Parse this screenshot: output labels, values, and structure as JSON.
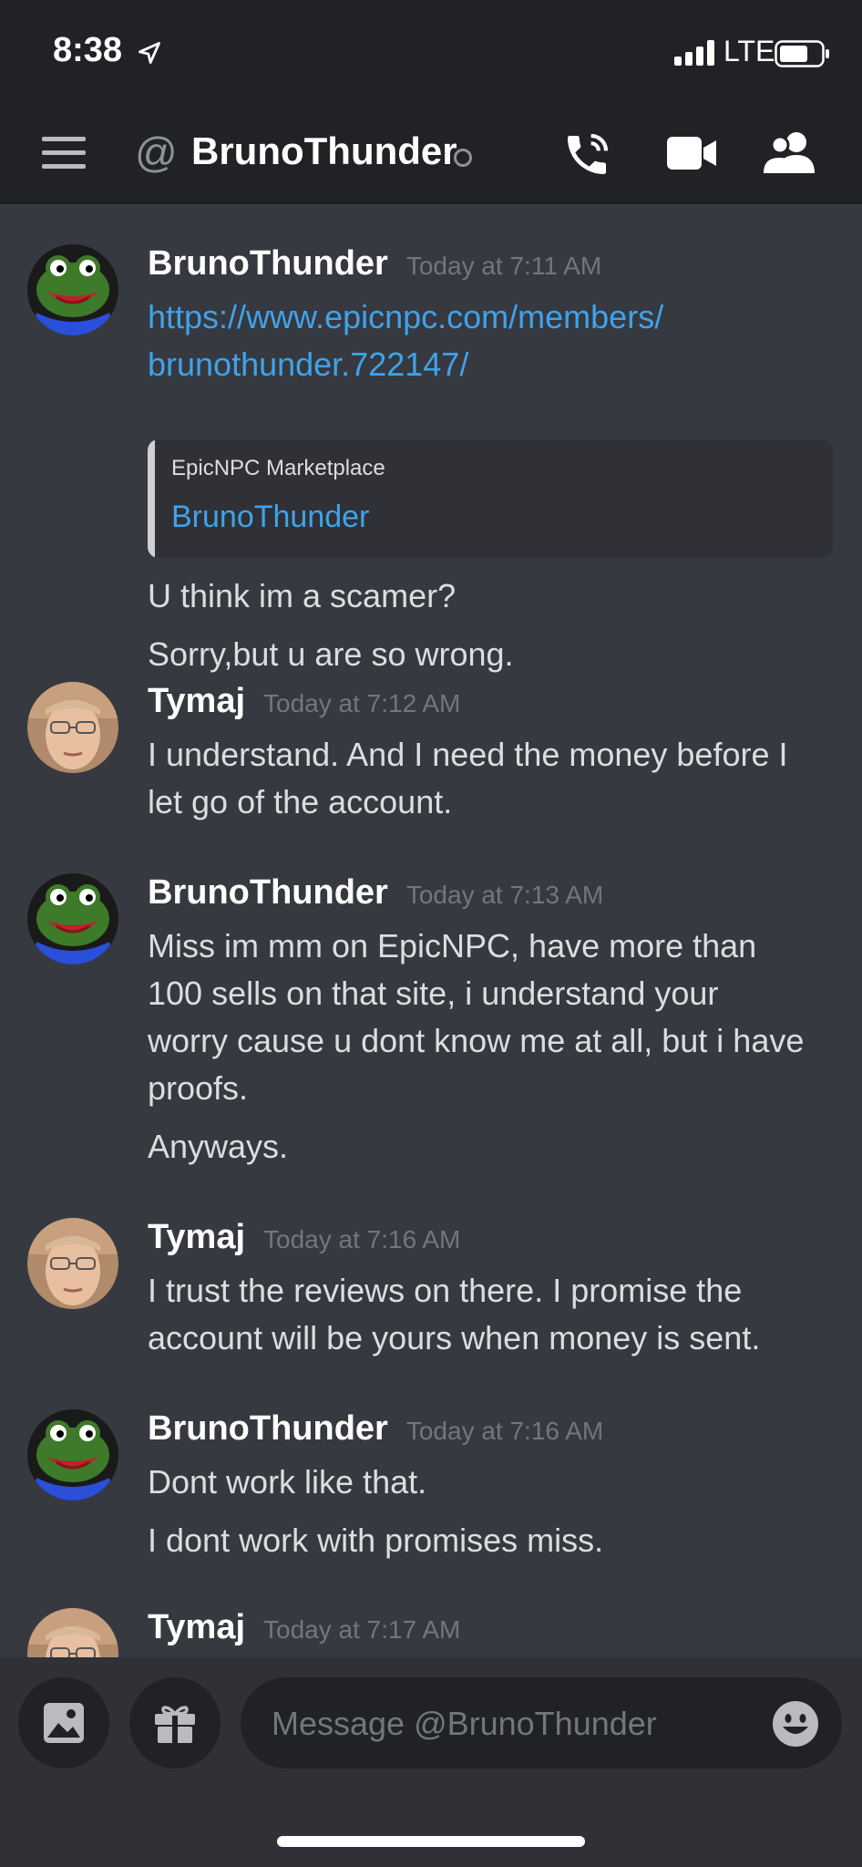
{
  "status_bar": {
    "time": "8:38",
    "network": "LTE"
  },
  "header": {
    "at_symbol": "@",
    "channel_name": "BrunoThunder"
  },
  "messages": [
    {
      "author": "BrunoThunder",
      "timestamp": "Today at 7:11 AM",
      "link_line1": "https://www.epicnpc.com/members/",
      "link_line2": "brunothunder.722147/",
      "embed": {
        "provider": "EpicNPC Marketplace",
        "title": "BrunoThunder"
      },
      "line1": "U think im a scamer?",
      "line2": "Sorry,but u are so wrong."
    },
    {
      "author": "Tymaj",
      "timestamp": "Today at 7:12 AM",
      "line1": "I understand. And I need the money before I",
      "line2": "let go of the account."
    },
    {
      "author": "BrunoThunder",
      "timestamp": "Today at 7:13 AM",
      "line1": "Miss im mm on EpicNPC, have more than",
      "line2": "100 sells on that site, i understand your",
      "line3": "worry cause u dont know me at all, but i have",
      "line4": "proofs.",
      "line5": "Anyways."
    },
    {
      "author": "Tymaj",
      "timestamp": "Today at 7:16 AM",
      "line1": "I trust the reviews on there. I promise the",
      "line2": "account will be yours when money is sent."
    },
    {
      "author": "BrunoThunder",
      "timestamp": "Today at 7:16 AM",
      "line1": "Dont work like that.",
      "line2": "I dont work with promises miss."
    },
    {
      "author": "Tymaj",
      "timestamp": "Today at 7:17 AM"
    }
  ],
  "composer": {
    "placeholder": "Message @BrunoThunder"
  },
  "colors": {
    "background": "#36393f",
    "header": "#202225",
    "link": "#3fa3ea",
    "timestamp": "#72767d"
  },
  "icons": [
    "location-arrow-icon",
    "signal-icon",
    "battery-icon",
    "menu-icon",
    "phone-call-icon",
    "video-camera-icon",
    "members-icon",
    "image-icon",
    "gift-icon",
    "emoji-icon"
  ]
}
